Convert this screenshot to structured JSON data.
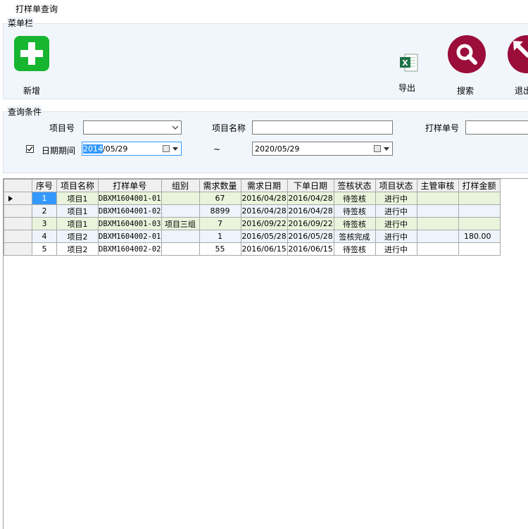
{
  "window": {
    "title": "打样单查询"
  },
  "menu_group": {
    "label": "菜单栏",
    "add_label": "新增",
    "export_label": "导出",
    "search_label": "搜索",
    "exit_label": "退出"
  },
  "query_group": {
    "label": "查询条件",
    "project_no_label": "项目号",
    "project_no_value": "",
    "project_name_label": "项目名称",
    "project_name_value": "",
    "sample_no_label": "打样单号",
    "sample_no_value": "",
    "date_range_label": "日期期间",
    "date_range_checked": true,
    "date_from_selected": "2014",
    "date_from_rest": "/05/29",
    "date_separator": "~",
    "date_to": "2020/05/29"
  },
  "grid": {
    "columns": [
      "序号",
      "项目名称",
      "打样单号",
      "组别",
      "需求数量",
      "需求日期",
      "下单日期",
      "签核状态",
      "项目状态",
      "主管审核",
      "打样金额"
    ],
    "rows": [
      {
        "no": "1",
        "project": "项目1",
        "sample_no": "DBXM1604001-01",
        "group": "",
        "qty": "67",
        "req_date": "2016/04/28",
        "order_date": "2016/04/28",
        "sign": "待签核",
        "status": "进行中",
        "review": "",
        "amount": ""
      },
      {
        "no": "2",
        "project": "项目1",
        "sample_no": "DBXM1604001-02",
        "group": "",
        "qty": "8899",
        "req_date": "2016/04/28",
        "order_date": "2016/04/28",
        "sign": "待签核",
        "status": "进行中",
        "review": "",
        "amount": ""
      },
      {
        "no": "3",
        "project": "项目1",
        "sample_no": "DBXM1604001-03",
        "group": "项目三组",
        "qty": "7",
        "req_date": "2016/09/22",
        "order_date": "2016/09/22",
        "sign": "待签核",
        "status": "进行中",
        "review": "",
        "amount": ""
      },
      {
        "no": "4",
        "project": "项目2",
        "sample_no": "DBXM1604002-01",
        "group": "",
        "qty": "1",
        "req_date": "2016/05/28",
        "order_date": "2016/05/28",
        "sign": "签核完成",
        "status": "进行中",
        "review": "",
        "amount": "180.00"
      },
      {
        "no": "5",
        "project": "项目2",
        "sample_no": "DBXM1604002-02",
        "group": "",
        "qty": "55",
        "req_date": "2016/06/15",
        "order_date": "2016/06/15",
        "sign": "待签核",
        "status": "进行中",
        "review": "",
        "amount": ""
      }
    ]
  },
  "icons": {
    "add": "plus-icon",
    "export": "excel-icon",
    "search": "magnifier-icon",
    "exit": "exit-arrow-icon"
  },
  "colors": {
    "add_green": "#17b530",
    "round_button": "#9b0d3a",
    "excel_green": "#1e7145",
    "selection_blue": "#3399ff",
    "alt_row_green": "#eaf4dc"
  }
}
